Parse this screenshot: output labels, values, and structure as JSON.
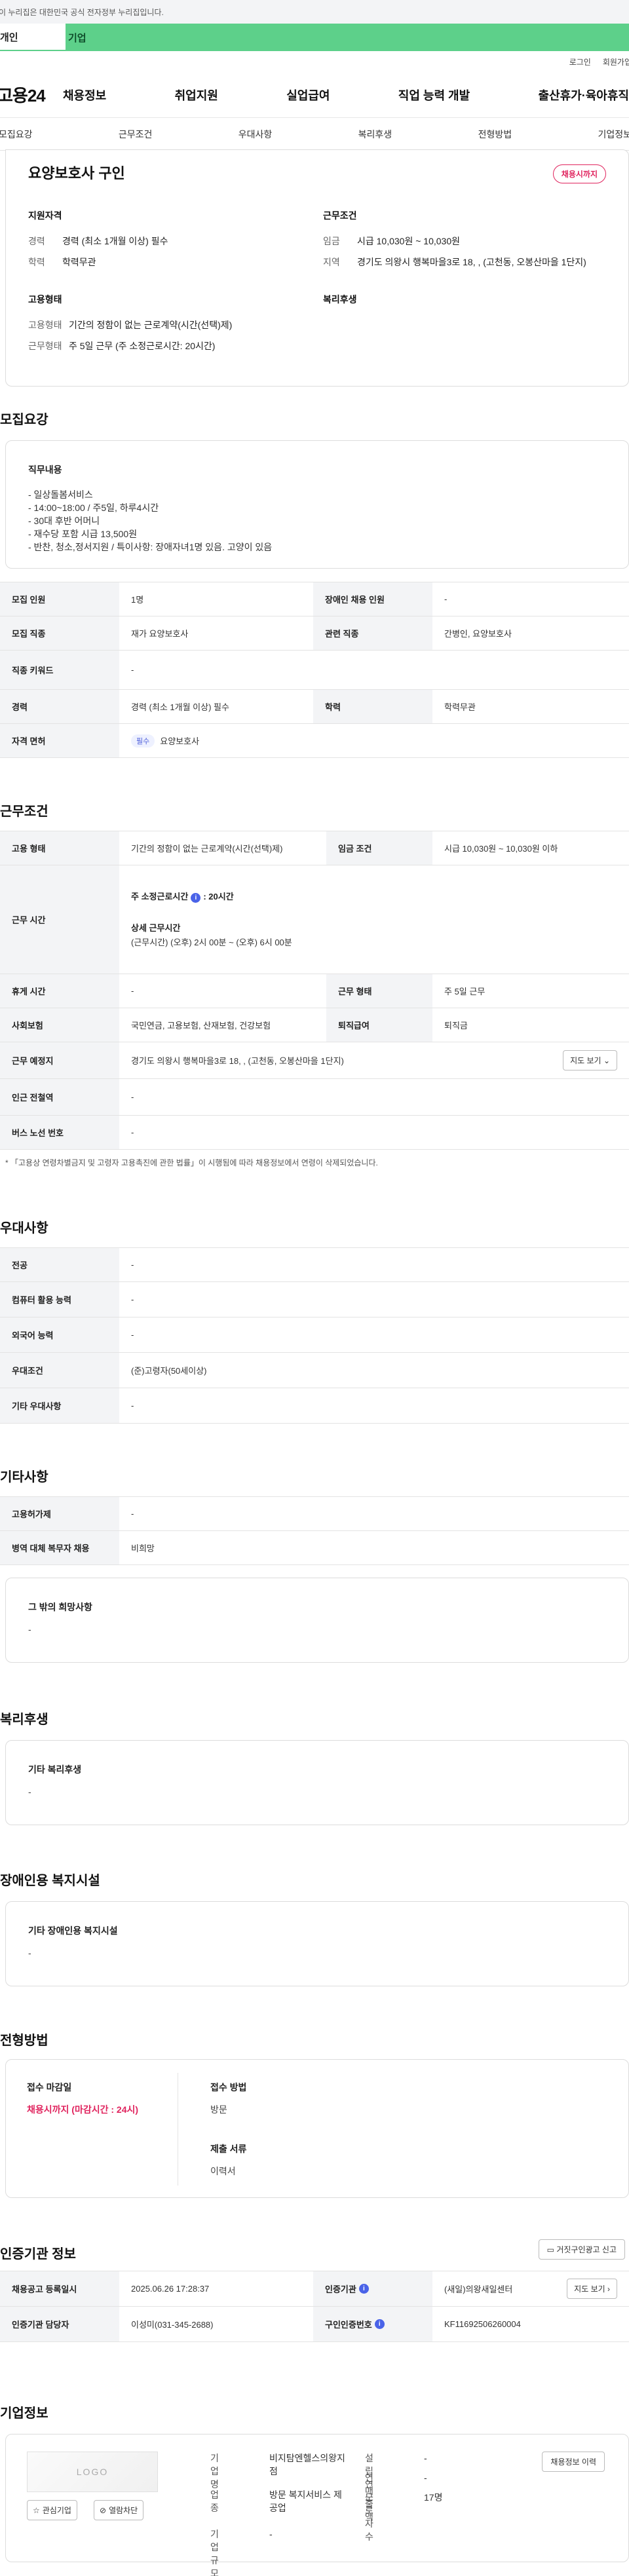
{
  "gov_banner": "이 누리집은 대한민국 공식 전자정부 누리집입니다.",
  "tabs": {
    "personal": "개인",
    "corporate": "기업"
  },
  "util": {
    "login": "로그인",
    "signup": "회원가입"
  },
  "logo": "고용24",
  "gnb": [
    "채용정보",
    "취업지원",
    "실업급여",
    "직업 능력 개발",
    "출산휴가·육아휴직"
  ],
  "subnav": [
    "모집요강",
    "근무조건",
    "우대사항",
    "복리후생",
    "전형방법",
    "기업정보"
  ],
  "summary": {
    "title": "요양보호사 구인",
    "badge": "채용시까지",
    "qual_h": "지원자격",
    "qual": [
      {
        "k": "경력",
        "v": "경력 (최소 1개월 이상) 필수"
      },
      {
        "k": "학력",
        "v": "학력무관"
      }
    ],
    "cond_h": "근무조건",
    "cond": [
      {
        "k": "임금",
        "v": "시급 10,030원 ~ 10,030원"
      },
      {
        "k": "지역",
        "v": "경기도 의왕시 행복마을3로 18, , (고천동, 오봉산마을 1단지)"
      }
    ],
    "emp_h": "고용형태",
    "emp": [
      {
        "k": "고용형태",
        "v": "기간의 정함이 없는 근로계약(시간(선택)제)"
      },
      {
        "k": "근무형태",
        "v": "주 5일 근무 (주 소정근로시간: 20시간)"
      }
    ],
    "welfare_h": "복리후생"
  },
  "recruit": {
    "title": "모집요강",
    "duty_h": "직무내용",
    "duty_lines": [
      "- 일상돌봄서비스",
      "- 14:00~18:00 / 주5일, 하루4시간",
      "- 30대 후반 어머니",
      "- 재수당 포함 시급 13,500원",
      "- 반찬, 청소,정서지원 / 특이사항: 장애자녀1명 있음. 고양이 있음"
    ],
    "rows": [
      {
        "k1": "모집 인원",
        "v1": "1명",
        "k2": "장애인 채용 인원",
        "v2": "-"
      },
      {
        "k1": "모집 직종",
        "v1": "재가 요양보호사",
        "k2": "관련 직종",
        "v2": "간병인, 요양보호사"
      },
      {
        "k1": "직종 키워드",
        "v1": "-"
      },
      {
        "k1": "경력",
        "v1": "경력 (최소 1개월 이상) 필수",
        "k2": "학력",
        "v2": "학력무관"
      },
      {
        "k1": "자격 면허",
        "pill": "필수",
        "v1": "요양보호사"
      }
    ]
  },
  "work": {
    "title": "근무조건",
    "emp_type_k": "고용 형태",
    "emp_type_v": "기간의 정함이 없는 근로계약(시간(선택)제)",
    "wage_k": "임금 조건",
    "wage_v": "시급 10,030원 ~ 10,030원 이하",
    "hours_k": "근무 시간",
    "hours_main": "주 소정근로시간",
    "hours_main_v": ": 20시간",
    "hours_detail_h": "상세 근무시간",
    "hours_detail_v": "(근무시간) (오후) 2시 00분 ~ (오후) 6시 00분",
    "rest_k": "휴게 시간",
    "rest_v": "-",
    "form_k": "근무 형태",
    "form_v": "주 5일 근무",
    "ins_k": "사회보험",
    "ins_v": "국민연금, 고용보험, 산재보험, 건강보험",
    "sev_k": "퇴직급여",
    "sev_v": "퇴직금",
    "loc_k": "근무 예정지",
    "loc_v": "경기도 의왕시 행복마을3로 18, , (고천동, 오봉산마을 1단지)",
    "map_btn": "지도 보기",
    "sub_k": "인근 전철역",
    "sub_v": "-",
    "bus_k": "버스 노선 번호",
    "bus_v": "-",
    "note": "* 「고용상 연령차별금지 및 고령자 고용촉진에 관한 법률」이 시행됨에 따라 채용정보에서 연령이 삭제되었습니다."
  },
  "pref": {
    "title": "우대사항",
    "rows": [
      {
        "k": "전공",
        "v": "-"
      },
      {
        "k": "컴퓨터 활용 능력",
        "v": "-"
      },
      {
        "k": "외국어 능력",
        "v": "-"
      },
      {
        "k": "우대조건",
        "v": "(준)고령자(50세이상)"
      },
      {
        "k": "기타 우대사항",
        "v": "-"
      }
    ]
  },
  "etc": {
    "title": "기타사항",
    "rows": [
      {
        "k": "고용허가제",
        "v": "-"
      },
      {
        "k": "병역 대체 복무자 채용",
        "v": "비희망"
      }
    ],
    "box_h": "그 밖의 희망사항",
    "box_v": "-"
  },
  "welfare": {
    "title": "복리후생",
    "box_h": "기타 복리후생",
    "box_v": "-"
  },
  "disab": {
    "title": "장애인용 복지시설",
    "box_h": "기타 장애인용 복지시설",
    "box_v": "-"
  },
  "apply": {
    "title": "전형방법",
    "deadline_h": "접수 마감일",
    "deadline_v": "채용시까지 (마감시간 : 24시)",
    "method_h": "접수 방법",
    "method_v": "방문",
    "docs_h": "제출 서류",
    "docs_v": "이력서"
  },
  "agency": {
    "title": "인증기관 정보",
    "report_btn": "거짓구인광고 신고",
    "reg_k": "채용공고 등록일시",
    "reg_v": "2025.06.26 17:28:37",
    "org_k": "인증기관",
    "org_v": "(새일)의왕새일센터",
    "map_btn": "지도 보기",
    "mgr_k": "인증기관 담당자",
    "mgr_v": "이성미(031-345-2688)",
    "num_k": "구인인증번호",
    "num_v": "KF11692506260004"
  },
  "company": {
    "title": "기업정보",
    "logo_text": "LOGO",
    "fav_btn": "관심기업",
    "block_btn": "열람차단",
    "name_k": "기업명",
    "name_v": "비지탐엔헬스의왕지점",
    "ind_k": "업종",
    "ind_v": "방문 복지서비스 제공업",
    "size_k": "기업규모",
    "size_v": "-",
    "year_k": "설립연도",
    "year_v": "-",
    "sales_k": "연매출액",
    "sales_v": "-",
    "emp_k": "근로자수",
    "emp_v": "17명",
    "history_btn": "채용정보 이력"
  }
}
